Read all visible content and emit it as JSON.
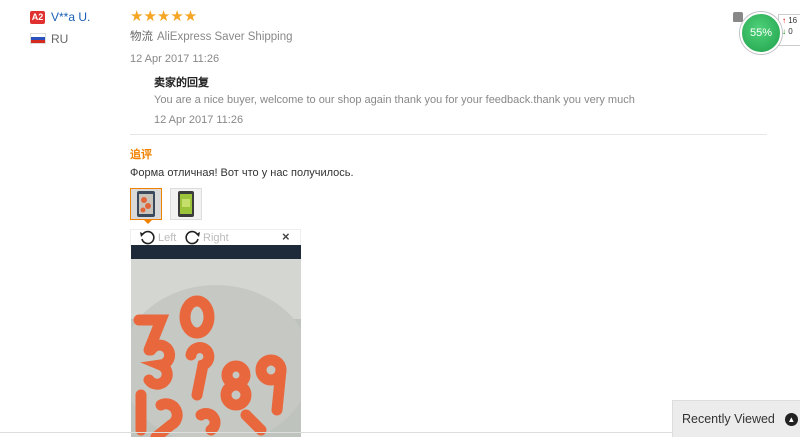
{
  "reviewer": {
    "badge": "A2",
    "name": "V**a U.",
    "country": "RU"
  },
  "review": {
    "stars": "★★★★★",
    "shipping_label": "物流",
    "shipping_value": "AliExpress Saver Shipping",
    "date": "12 Apr 2017 11:26"
  },
  "seller_reply": {
    "title": "卖家的回复",
    "text": "You are a nice buyer, welcome to our shop again thank you for your feedback.thank you very much",
    "date": "12 Apr 2017 11:26"
  },
  "additional": {
    "title": "追评",
    "text": "Форма отличная! Вот что у нас получилось."
  },
  "viewer": {
    "rotate_left": "Left",
    "rotate_right": "Right",
    "close": "×"
  },
  "rating_widget": {
    "percent": "55%",
    "line1_arrow": "↑",
    "line1_val": "16",
    "line2_arrow": "↓",
    "line2_val": "0"
  },
  "recently_viewed": {
    "label": "Recently Viewed"
  },
  "colors": {
    "accent": "#f08200",
    "star": "#f5a623",
    "link": "#1a5fb4",
    "rating_green": "#1f9f4a"
  }
}
